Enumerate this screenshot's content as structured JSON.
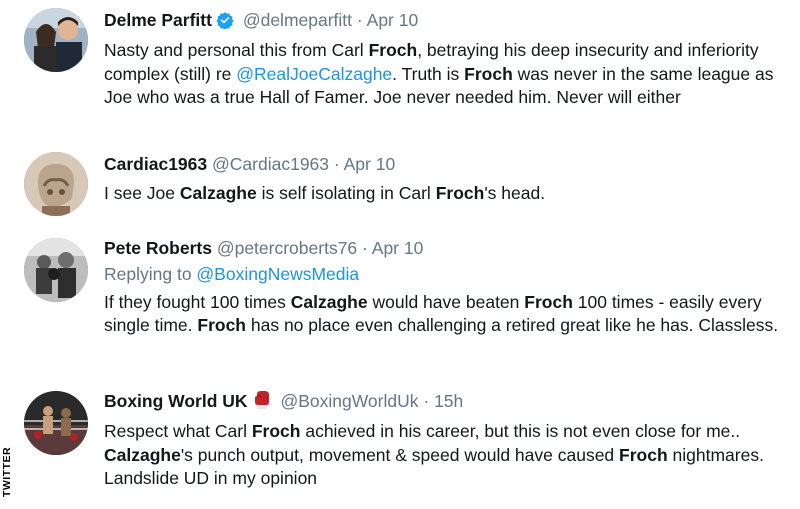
{
  "tweets": [
    {
      "name": "Delme Parfitt",
      "verified": true,
      "handle": "@delmeparfitt",
      "dot": "·",
      "time": "Apr 10",
      "avatar": "avatar-couple-photo",
      "text": [
        {
          "t": "Nasty and personal this from Carl "
        },
        {
          "b": "Froch"
        },
        {
          "t": ", betraying his deep insecurity and inferiority complex (still) re "
        },
        {
          "m": "@RealJoeCalzaghe"
        },
        {
          "t": ". Truth is "
        },
        {
          "b": "Froch"
        },
        {
          "t": " was never in the same league as Joe who was a true Hall of Famer. Joe never needed him. Never will either"
        }
      ]
    },
    {
      "name": "Cardiac1963",
      "handle": "@Cardiac1963",
      "dot": "·",
      "time": "Apr 10",
      "avatar": "avatar-boxing-glove-photo",
      "text": [
        {
          "t": "I see Joe "
        },
        {
          "b": "Calzaghe"
        },
        {
          "t": " is self isolating in Carl "
        },
        {
          "b": "Froch"
        },
        {
          "t": "'s head."
        }
      ]
    },
    {
      "name": "Pete Roberts",
      "handle": "@petercroberts76",
      "dot": "·",
      "time": "Apr 10",
      "avatar": "avatar-boxer-bw-photo",
      "replying_prefix": "Replying to ",
      "replying_to": "@BoxingNewsMedia",
      "text": [
        {
          "t": "If they fought 100 times "
        },
        {
          "b": "Calzaghe"
        },
        {
          "t": " would have beaten "
        },
        {
          "b": "Froch"
        },
        {
          "t": " 100 times - easily every single time.  "
        },
        {
          "b": "Froch"
        },
        {
          "t": " has no place even challenging a retired great like he has. Classless."
        }
      ]
    },
    {
      "name": "Boxing World UK",
      "glove": true,
      "handle": "@BoxingWorldUk",
      "dot": "·",
      "time": "15h",
      "avatar": "avatar-boxing-ring-photo",
      "text": [
        {
          "t": "Respect what Carl "
        },
        {
          "b": "Froch"
        },
        {
          "t": " achieved in his career, but this is not even close for me.. "
        },
        {
          "b": "Calzaghe"
        },
        {
          "t": "'s punch output, movement & speed would have caused "
        },
        {
          "b": "Froch"
        },
        {
          "t": " nightmares. Landslide UD in my opinion"
        }
      ]
    }
  ],
  "watermark": "TWITTER",
  "colors": {
    "link": "#1b95e0",
    "muted": "#657786",
    "text": "#14171a",
    "verified": "#1da1f2",
    "glove": "#c0242b"
  }
}
